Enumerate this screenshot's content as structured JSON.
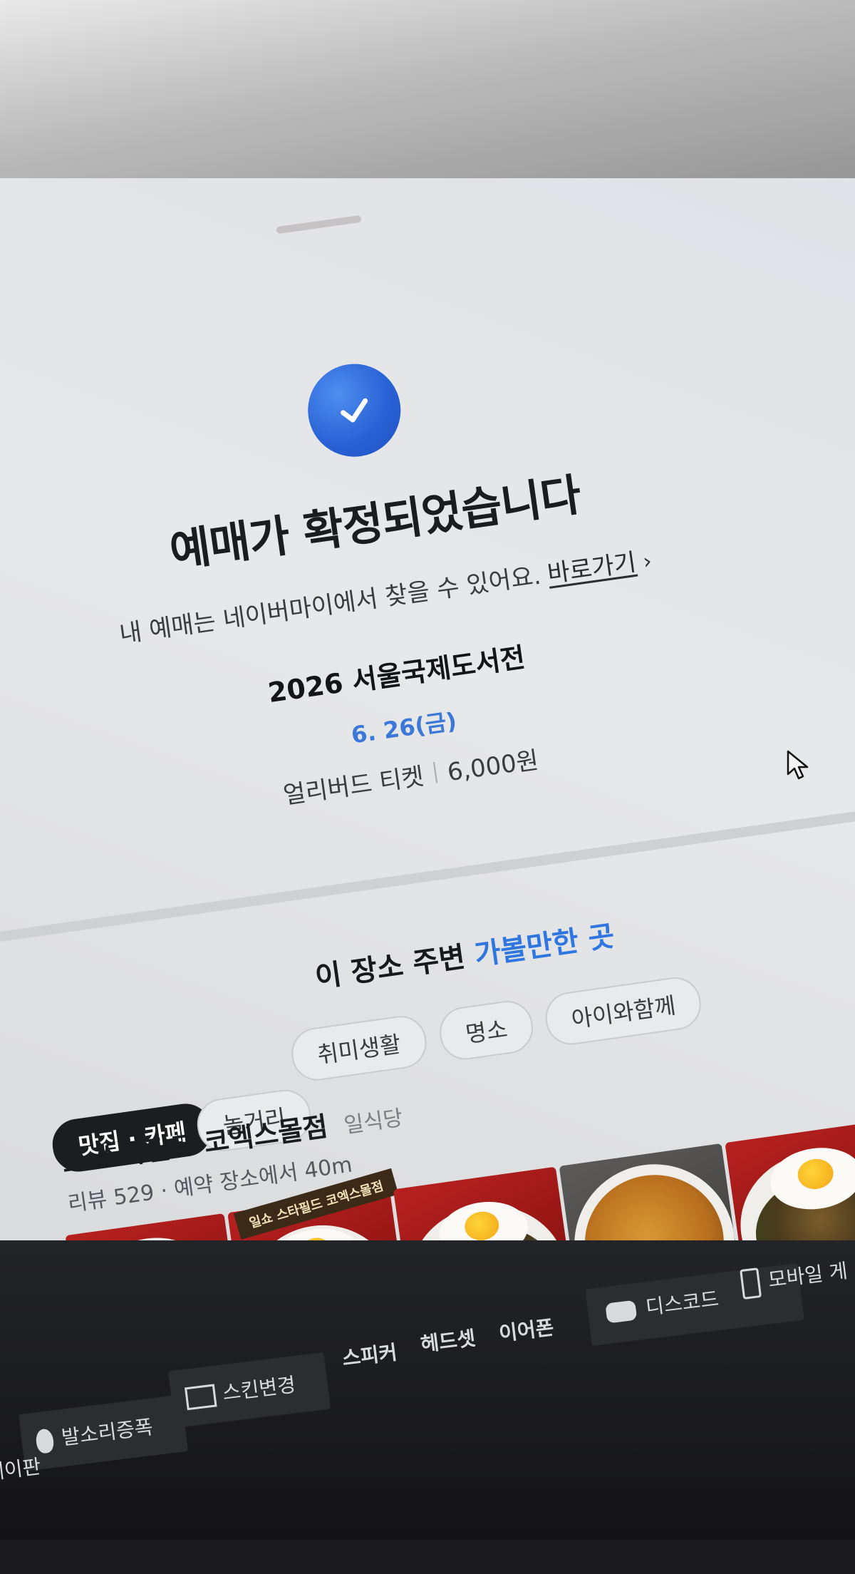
{
  "confirmation": {
    "title": "예매가 확정되었습니다",
    "subtitle": "내 예매는 네이버마이에서 찾을 수 있어요.",
    "link_label": "바로가기",
    "link_chevron": "›",
    "check_icon": "check-circle-icon",
    "accent_color": "#2a63d6"
  },
  "ticket": {
    "event_name": "2026 서울국제도서전",
    "date": "6. 26(금)",
    "ticket_type": "얼리버드 티켓",
    "price": "6,000원"
  },
  "nearby": {
    "title_prefix": "이 장소 주변",
    "title_accent": "가볼만한 곳",
    "categories_row1": [
      "취미생활",
      "명소",
      "아이와함께"
    ],
    "categories_row2": [
      "맛집 · 카페",
      "놀거리"
    ],
    "active_category": "맛집 · 카페"
  },
  "place": {
    "name": "쇼 스타필드 코엑스몰점",
    "category": "일식당",
    "meta": "리뷰 529 · 예약 장소에서 40m",
    "photo_sign_text": "일쇼 스타필드 코엑스몰점"
  },
  "taskbar": {
    "items": [
      "디스코드",
      "모바일 게",
      "스피커",
      "헤드셋",
      "이어폰",
      "스킨변경",
      "발소리증폭",
      "게이판"
    ]
  }
}
